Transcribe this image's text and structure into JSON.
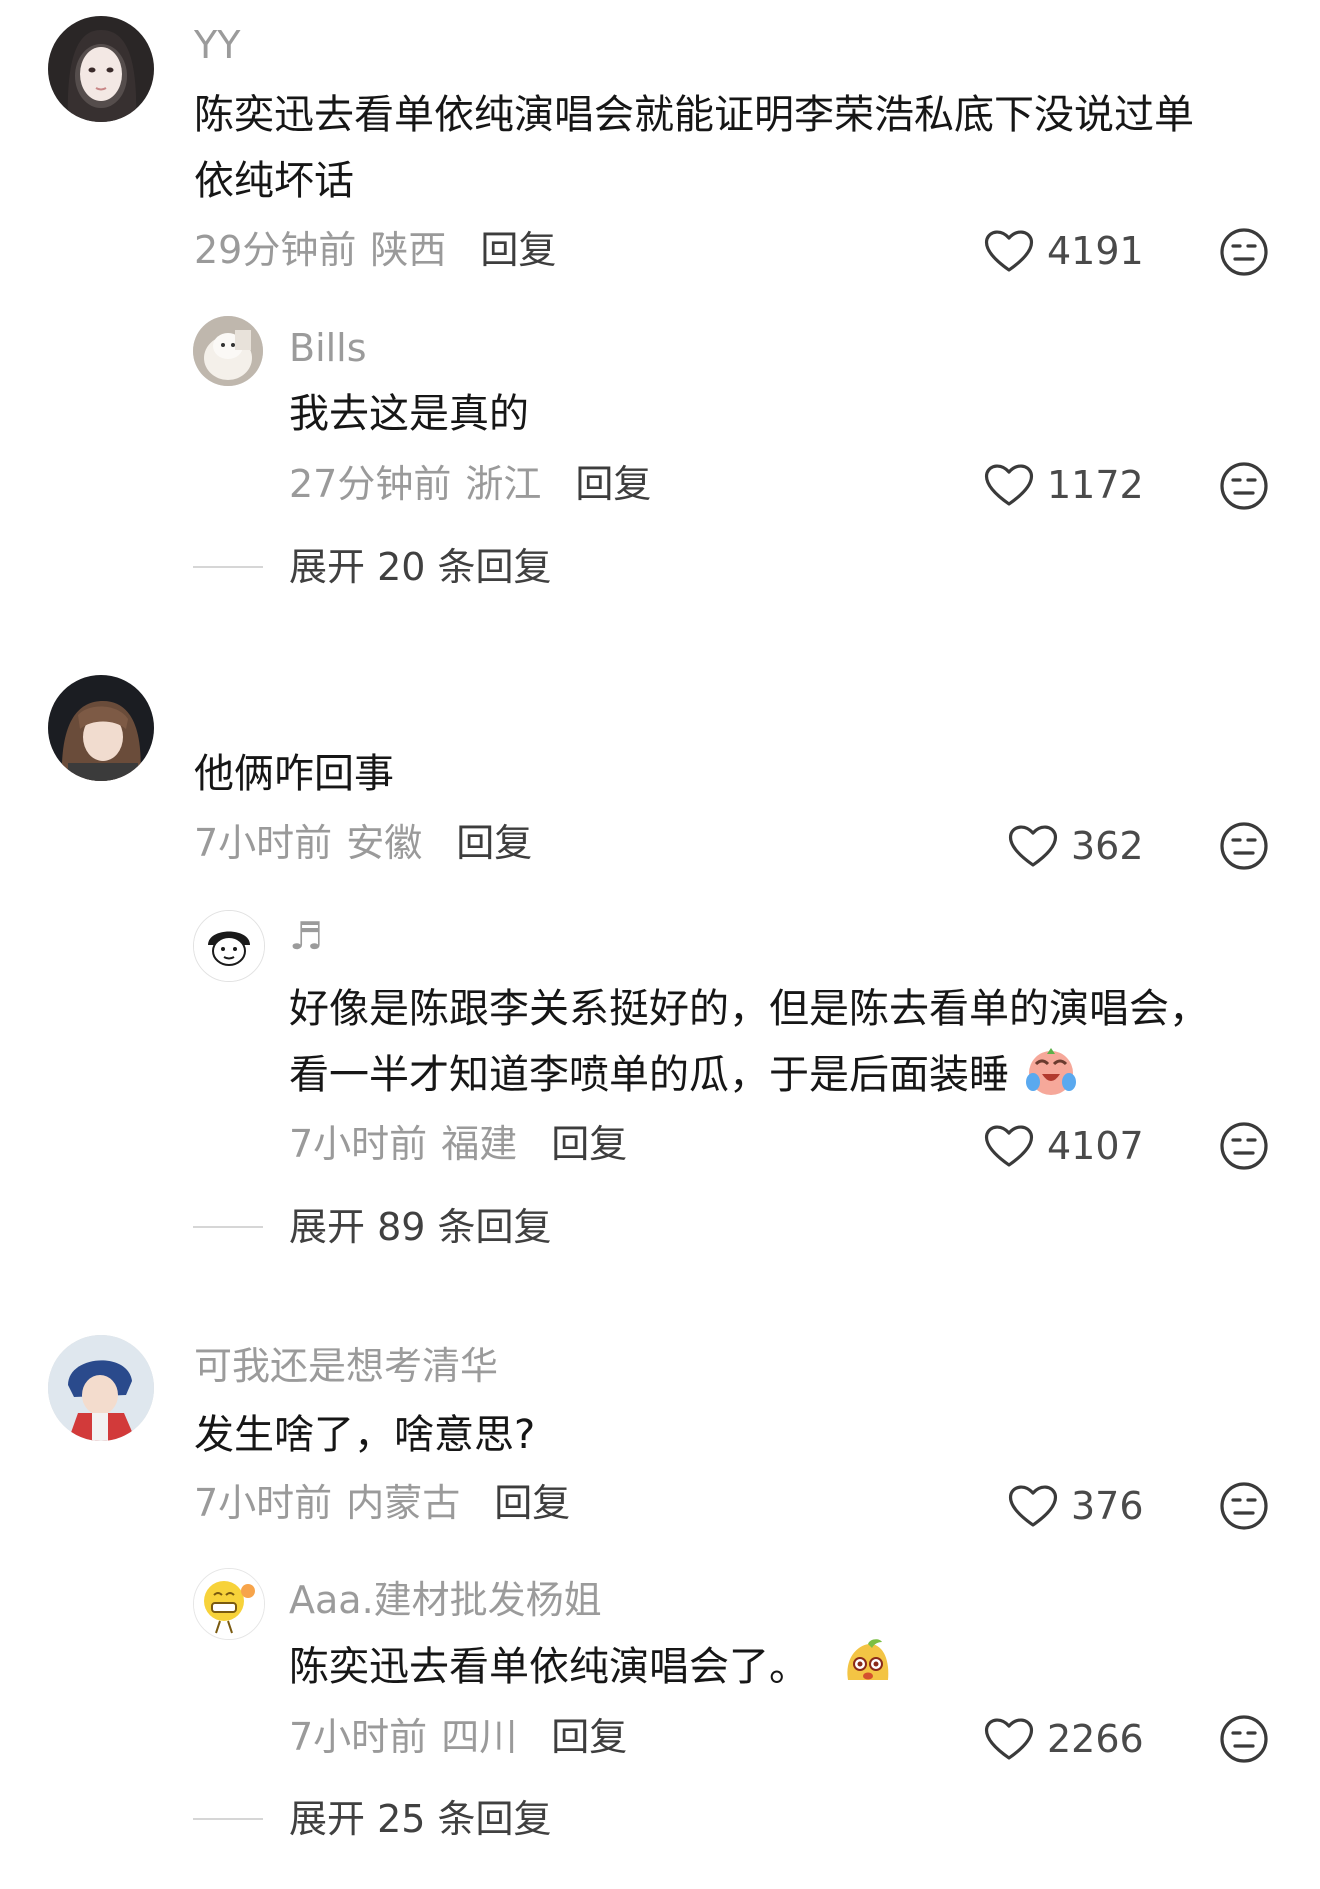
{
  "threads": [
    {
      "comment": {
        "user": "YY",
        "text_lines": [
          "陈奕迅去看单依纯演唱会就能证明李荣浩私底下没说过单",
          "依纯坏话"
        ],
        "time": "29分钟前",
        "location": "陕西",
        "reply_label": "回复",
        "likes": "4191"
      },
      "reply": {
        "user": "Bills",
        "text_lines": [
          "我去这是真的"
        ],
        "time": "27分钟前",
        "location": "浙江",
        "reply_label": "回复",
        "likes": "1172"
      },
      "expand_label": "展开 20 条回复"
    },
    {
      "comment": {
        "user": "",
        "text_lines": [
          "他俩咋回事"
        ],
        "time": "7小时前",
        "location": "安徽",
        "reply_label": "回复",
        "likes": "362"
      },
      "reply": {
        "user": "♬",
        "text_lines": [
          "好像是陈跟李关系挺好的，但是陈去看单的演唱会，",
          "看一半才知道李喷单的瓜，于是后面装睡"
        ],
        "time": "7小时前",
        "location": "福建",
        "reply_label": "回复",
        "likes": "4107"
      },
      "expand_label": "展开 89 条回复"
    },
    {
      "comment": {
        "user": "可我还是想考清华",
        "text_lines": [
          "发生啥了，啥意思?"
        ],
        "time": "7小时前",
        "location": "内蒙古",
        "reply_label": "回复",
        "likes": "376"
      },
      "reply": {
        "user": "Aaa.建材批发杨姐",
        "text_lines": [
          "陈奕迅去看单依纯演唱会了。"
        ],
        "time": "7小时前",
        "location": "四川",
        "reply_label": "回复",
        "likes": "2266"
      },
      "expand_label": "展开 25 条回复"
    }
  ],
  "icons": {
    "like": "heart-outline-icon",
    "dislike": "neutral-face-icon",
    "emoji_thread2": "crying-laugh-emoji",
    "emoji_thread3": "cute-animal-emoji"
  },
  "colors": {
    "username": "#9b9b9b",
    "text": "#161616",
    "meta": "#9a9a9a",
    "reply_button": "#3d3d3d"
  }
}
